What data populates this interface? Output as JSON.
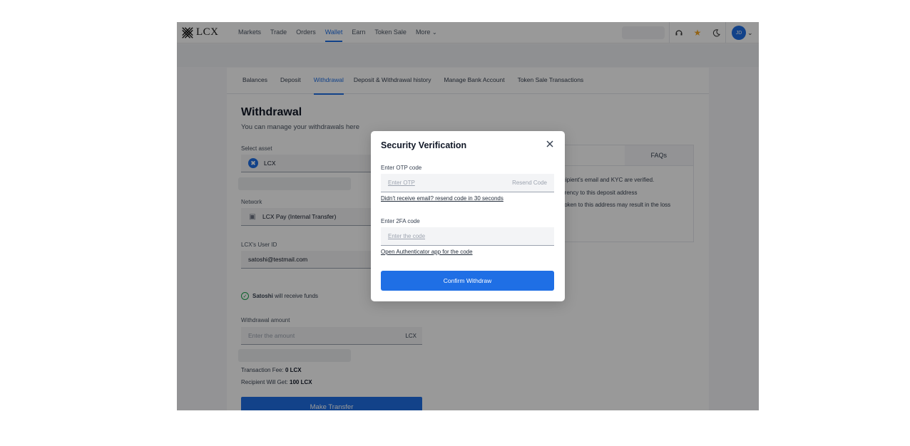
{
  "brand": {
    "name": "LCX"
  },
  "nav": {
    "items": [
      {
        "label": "Markets"
      },
      {
        "label": "Trade"
      },
      {
        "label": "Orders"
      },
      {
        "label": "Wallet",
        "active": true
      },
      {
        "label": "Earn"
      },
      {
        "label": "Token Sale"
      },
      {
        "label": "More"
      }
    ],
    "avatar_initials": "JD"
  },
  "tabs": [
    {
      "label": "Balances"
    },
    {
      "label": "Deposit"
    },
    {
      "label": "Withdrawal",
      "active": true
    },
    {
      "label": "Deposit & Withdrawal history"
    },
    {
      "label": "Manage Bank Account"
    },
    {
      "label": "Token Sale Transactions"
    }
  ],
  "page": {
    "title": "Withdrawal",
    "subtitle": "You can manage your withdrawals here"
  },
  "form": {
    "asset_label": "Select asset",
    "asset_value": "LCX",
    "network_label": "Network",
    "network_value": "LCX Pay (Internal Transfer)",
    "user_id_label": "LCX's User ID",
    "user_id_value": "satoshi@testmail.com",
    "verify_name": "Satoshi",
    "verify_text": " will receive funds",
    "amount_label": "Withdrawal amount",
    "amount_placeholder": "Enter the amount",
    "amount_unit": "LCX",
    "fee_label": "Transaction Fee: ",
    "fee_value": "0 LCX",
    "recipient_label": "Recipient Will Get: ",
    "recipient_value": "100 LCX",
    "submit_label": "Make Transfer"
  },
  "info_panel": {
    "tab_faq": "FAQs",
    "lines": [
      "cipient's email and KYC are verified.",
      "rrency to this deposit address",
      "token to this address may result in the loss"
    ]
  },
  "modal": {
    "title": "Security Verification",
    "otp_label": "Enter OTP code",
    "otp_placeholder": "Enter OTP",
    "resend_label": "Resend Code",
    "otp_link": "Didn't receive email? resend code in 30 seconds",
    "twofa_label": "Enter 2FA code",
    "twofa_placeholder": "Enter the code",
    "twofa_link": "Open Authenticator app for the code",
    "confirm_label": "Confirm Withdraw"
  },
  "colors": {
    "accent": "#1f6fe5",
    "success": "#16a34a"
  }
}
